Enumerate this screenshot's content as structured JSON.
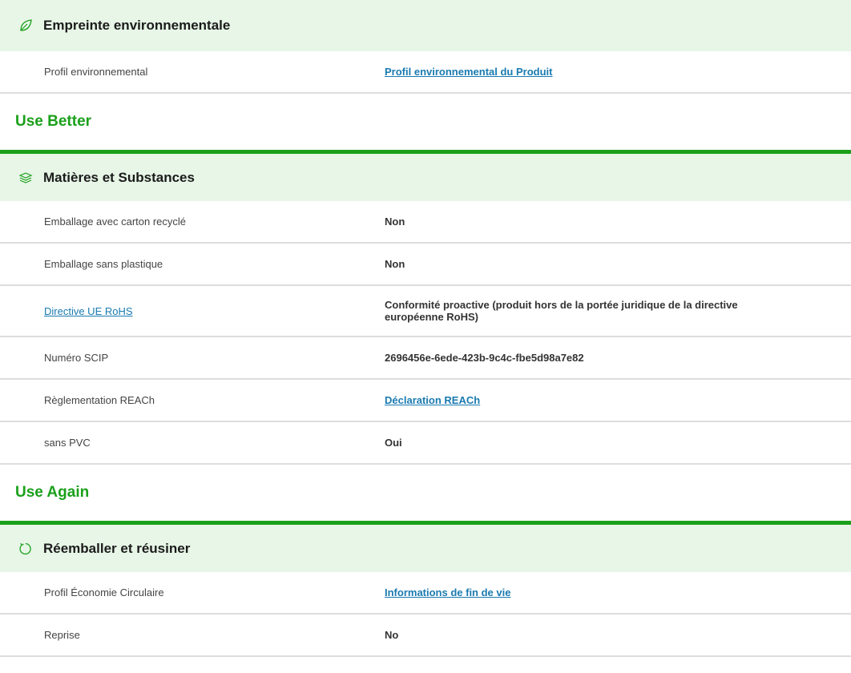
{
  "sections": [
    {
      "title": "Empreinte environnementale",
      "icon": "leaf-icon",
      "rows": [
        {
          "label": "Profil environnemental",
          "value": "Profil environnemental du Produit"
        }
      ]
    },
    {
      "title": "Matières et Substances",
      "icon": "layers-icon",
      "rows": [
        {
          "label": "Emballage avec carton recyclé",
          "value": "Non"
        },
        {
          "label": "Emballage sans plastique",
          "value": "Non"
        },
        {
          "label": "Directive UE RoHS",
          "value": "Conformité proactive (produit hors de la portée juridique de la directive européenne RoHS)"
        },
        {
          "label": "Numéro SCIP",
          "value": "2696456e-6ede-423b-9c4c-fbe5d98a7e82"
        },
        {
          "label": "Règlementation REACh",
          "value": "Déclaration REACh"
        },
        {
          "label": "sans PVC",
          "value": "Oui"
        }
      ]
    },
    {
      "title": "Réemballer et réusiner",
      "icon": "refresh-icon",
      "rows": [
        {
          "label": "Profil Économie Circulaire",
          "value": "Informations de fin de vie"
        },
        {
          "label": "Reprise",
          "value": "No"
        }
      ]
    }
  ],
  "categories": [
    "Use Better",
    "Use Again"
  ],
  "colors": {
    "accent_green": "#1ba01b",
    "header_bg": "#e7f6e7",
    "link_blue": "#1a7ab0",
    "divider": "#dddddd"
  }
}
